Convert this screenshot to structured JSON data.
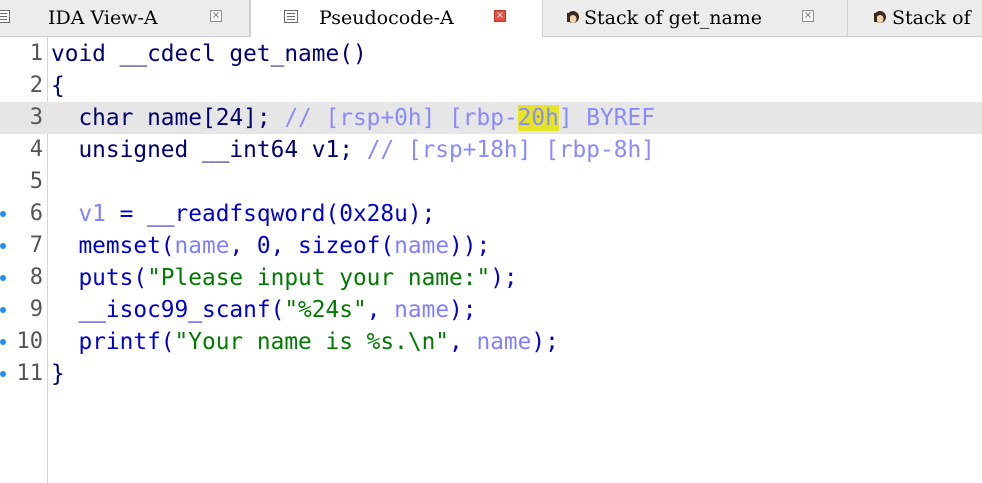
{
  "tabs": [
    {
      "label": "IDA View-A",
      "icon": "ida-view-icon",
      "active": false
    },
    {
      "label": "Pseudocode-A",
      "icon": "pseudocode-icon",
      "active": true
    },
    {
      "label": "Stack of get_name",
      "icon": "stack-frame-icon",
      "active": false
    },
    {
      "label": "Stack of",
      "icon": "stack-frame-icon",
      "active": false
    }
  ],
  "tab_close_glyph": "×",
  "line_numbers": [
    "1",
    "2",
    "3",
    "4",
    "5",
    "6",
    "7",
    "8",
    "9",
    "10",
    "11"
  ],
  "code": {
    "l1": {
      "kw": "void __cdecl get_name()"
    },
    "l2": {
      "text": "{"
    },
    "l3": {
      "decl": "  char name[24]; ",
      "cmt_a": "// [rsp+0h] [rbp-",
      "cmt_hl": "20h",
      "cmt_b": "] BYREF"
    },
    "l4": {
      "decl": "  unsigned __int64 v1; ",
      "cmt": "// [rsp+18h] [rbp-8h]"
    },
    "l6": {
      "var": "v1",
      "rest": " = __readfsqword(0x28u);"
    },
    "l7": {
      "a": "memset(",
      "v1": "name",
      "b": ", 0, sizeof(",
      "v2": "name",
      "c": "));"
    },
    "l8": {
      "a": "puts(",
      "s": "\"Please input your name:\"",
      "b": ");"
    },
    "l9": {
      "a": "__isoc99_scanf(",
      "s": "\"%24s\"",
      "b": ", ",
      "v": "name",
      "c": ");"
    },
    "l10": {
      "a": "printf(",
      "s": "\"Your name is %s.\\n\"",
      "b": ", ",
      "v": "name",
      "c": ");"
    },
    "l11": {
      "text": "}"
    }
  },
  "colors": {
    "keyword": "#00006e",
    "function": "#0000cc",
    "variable": "#8080ff",
    "string": "#007a00",
    "comment": "#8a8aff",
    "highlight": "#e5e526",
    "current_line": "#e6e6e6",
    "breakpoint_dot": "#1f8fe0"
  }
}
